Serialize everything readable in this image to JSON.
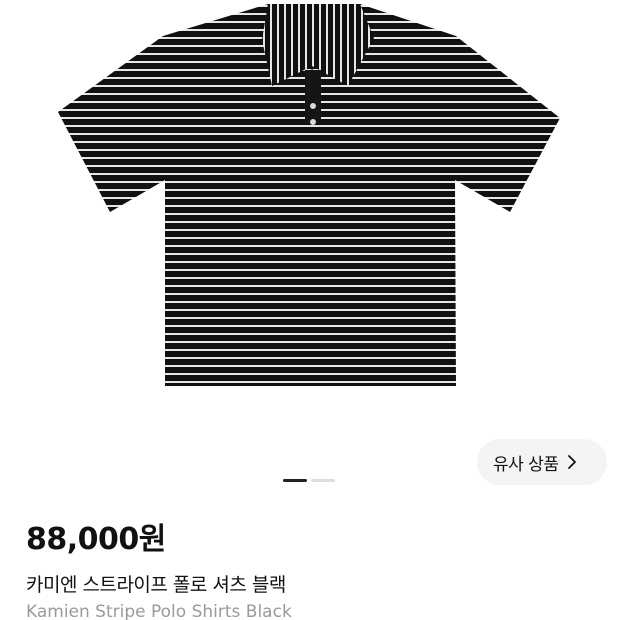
{
  "product": {
    "image_icon": "striped-polo-shirt-photo",
    "shirt_colors": {
      "body": "#111111",
      "stripe": "#e6e6e6"
    },
    "similar_button_label": "유사 상품",
    "similar_button_icon": "chevron-right-icon",
    "carousel": {
      "current": 1,
      "total": 2
    },
    "price": "88,000원",
    "name_ko": "카미엔 스트라이프 폴로 셔츠 블랙",
    "name_en": "Kamien Stripe Polo Shirts Black"
  }
}
